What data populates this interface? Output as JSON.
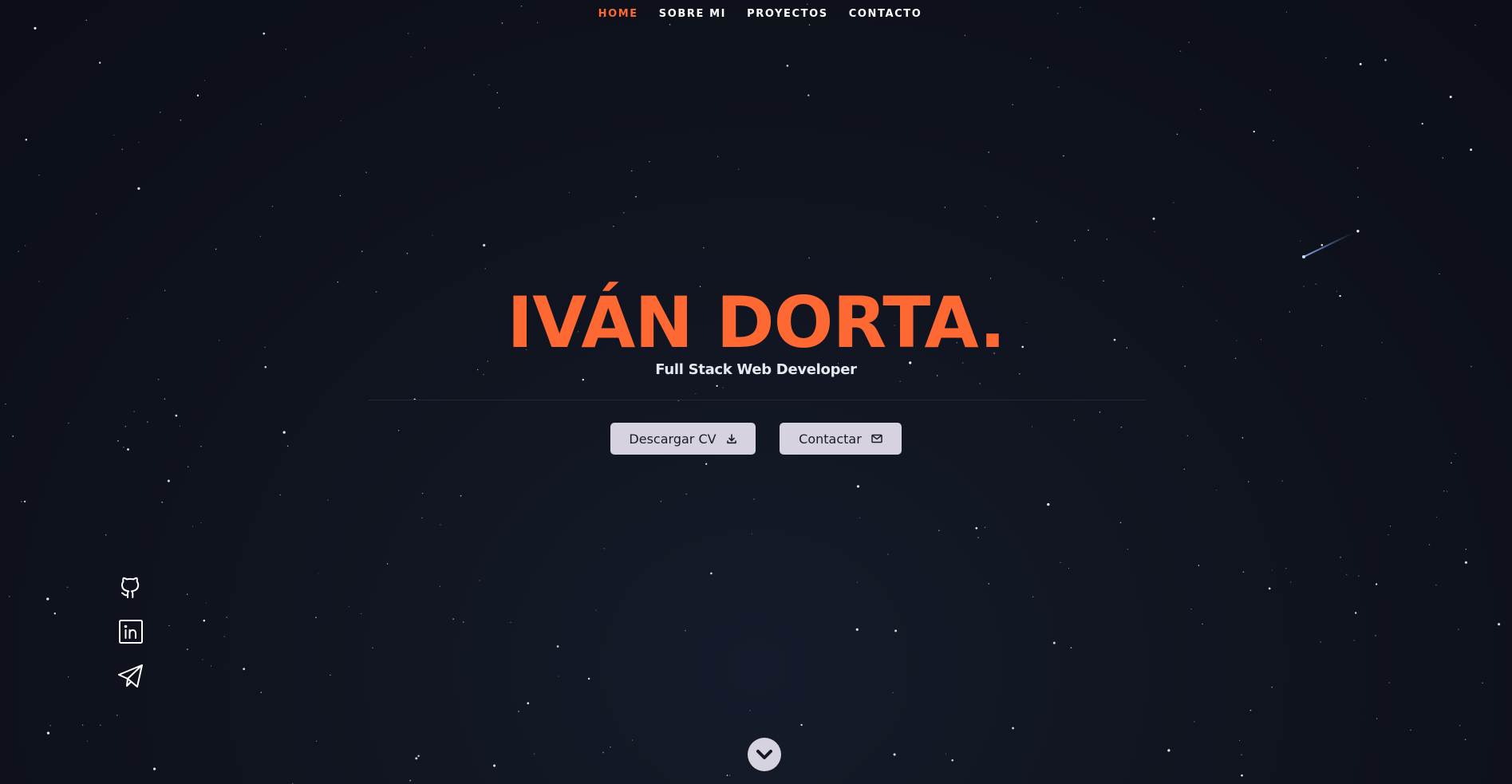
{
  "nav": {
    "items": [
      {
        "label": "HOME",
        "active": true
      },
      {
        "label": "SOBRE MI",
        "active": false
      },
      {
        "label": "PROYECTOS",
        "active": false
      },
      {
        "label": "CONTACTO",
        "active": false
      }
    ]
  },
  "hero": {
    "title": "IVÁN DORTA.",
    "subtitle": "Full Stack Web Developer"
  },
  "buttons": {
    "download_cv": {
      "label": "Descargar CV",
      "icon": "download-icon"
    },
    "contact": {
      "label": "Contactar",
      "icon": "mail-icon"
    }
  },
  "social": {
    "icons": [
      "github-icon",
      "linkedin-icon",
      "telegram-icon"
    ]
  },
  "scroll": {
    "icon": "chevron-down-icon"
  },
  "colors": {
    "accent": "#fe6833",
    "background": "#0b0e16",
    "button": "#d7d2df",
    "text": "#ffffff"
  }
}
